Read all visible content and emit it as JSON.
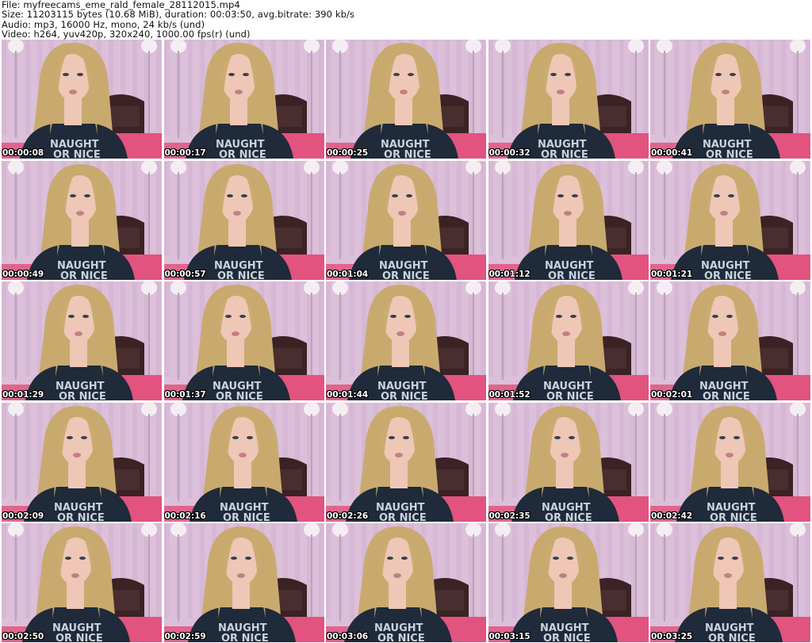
{
  "header": {
    "file_line": "File: myfreecams_eme_rald_female_28112015.mp4",
    "size_line": "Size: 11203115 bytes (10.68 MiB), duration: 00:03:50, avg.bitrate: 390 kb/s",
    "audio_line": "Audio: mp3, 16000 Hz, mono, 24 kb/s (und)",
    "video_line": "Video: h264, yuv420p, 320x240, 1000.00 fps(r) (und)"
  },
  "thumbnails": [
    {
      "timestamp": "00:00:08"
    },
    {
      "timestamp": "00:00:17"
    },
    {
      "timestamp": "00:00:25"
    },
    {
      "timestamp": "00:00:32"
    },
    {
      "timestamp": "00:00:41"
    },
    {
      "timestamp": "00:00:49"
    },
    {
      "timestamp": "00:00:57"
    },
    {
      "timestamp": "00:01:04"
    },
    {
      "timestamp": "00:01:12"
    },
    {
      "timestamp": "00:01:21"
    },
    {
      "timestamp": "00:01:29"
    },
    {
      "timestamp": "00:01:37"
    },
    {
      "timestamp": "00:01:44"
    },
    {
      "timestamp": "00:01:52"
    },
    {
      "timestamp": "00:02:01"
    },
    {
      "timestamp": "00:02:09"
    },
    {
      "timestamp": "00:02:16"
    },
    {
      "timestamp": "00:02:26"
    },
    {
      "timestamp": "00:02:35"
    },
    {
      "timestamp": "00:02:42"
    },
    {
      "timestamp": "00:02:50"
    },
    {
      "timestamp": "00:02:59"
    },
    {
      "timestamp": "00:03:06"
    },
    {
      "timestamp": "00:03:15"
    },
    {
      "timestamp": "00:03:25"
    }
  ],
  "colors": {
    "wall": "#dcbfd9",
    "wall_stripe": "#cfaed0",
    "bed": "#e2537f",
    "headboard": "#3b2224",
    "hair": "#c9aa6e",
    "skin": "#eec7b6",
    "shirt": "#1f2a3a",
    "shirt_text": "#c9d3de",
    "lamp": "#f4eef3"
  }
}
